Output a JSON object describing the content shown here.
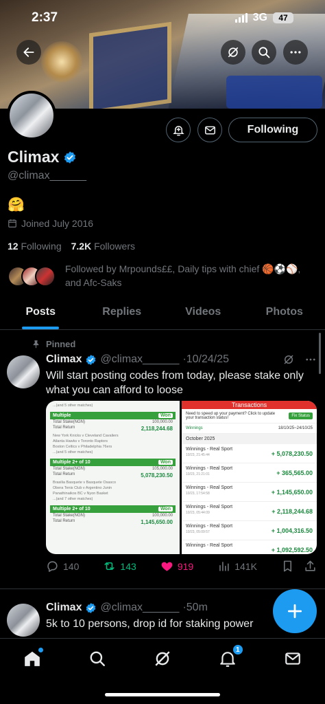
{
  "status_bar": {
    "time": "2:37",
    "network": "3G",
    "battery": "47"
  },
  "profile": {
    "name": "Climax",
    "handle": "@climax______",
    "bio_emoji": "🤗",
    "joined": "Joined July 2016",
    "following_count": "12",
    "following_label": "Following",
    "followers_count": "7.2K",
    "followers_label": "Followers",
    "followed_by": "Followed by Mrpounds££, Daily tips with chief 🏀⚽⚾, and Afc-Saks",
    "follow_button": "Following"
  },
  "tabs": [
    {
      "label": "Posts",
      "active": true
    },
    {
      "label": "Replies",
      "active": false
    },
    {
      "label": "Videos",
      "active": false
    },
    {
      "label": "Photos",
      "active": false
    }
  ],
  "pinned_label": "Pinned",
  "posts": [
    {
      "name": "Climax",
      "handle": "@climax______",
      "date": "·10/24/25",
      "text": "Will start posting codes from today, please stake only what you can afford to loose",
      "replies": "140",
      "reposts": "143",
      "likes": "919",
      "views": "141K",
      "media": {
        "left": {
          "header_note": "...(and 5 other matches)",
          "bets": [
            {
              "label": "Multiple",
              "status": "Won",
              "stake_label": "Total Stake(NGN)",
              "stake": "100,000.00",
              "return_label": "Total Return",
              "return": "2,118,244.68",
              "teams": [
                "New York Knicks v Cleveland Cavaliers",
                "Atlanta Hawks v Toronto Raptors",
                "Boston Celtics v Philadelphia 76ers",
                "...(and 5 other matches)"
              ]
            },
            {
              "label": "Multiple",
              "odds": "2+ of 10",
              "status": "Won",
              "stake_label": "Total Stake(NGN)",
              "stake": "105,000.00",
              "return_label": "Total Return",
              "return": "5,078,230.50",
              "teams": [
                "Brasilia Basquete v Basquete Osasco",
                "Obera Tenis Club v Argentino Junin",
                "Panathinaikos BC v Nyon Basket",
                "...(and 7 other matches)"
              ]
            },
            {
              "label": "Multiple",
              "odds": "2+ of 10",
              "status": "Won",
              "stake_label": "Total Stake(NGN)",
              "stake": "100,000.00",
              "return_label": "Total Return",
              "return": "1,145,650.00",
              "teams": []
            }
          ]
        },
        "right": {
          "title": "Transactions",
          "banner": "Need to speed up your payment? Click to update your transaction status!",
          "fix_button": "Fix Status",
          "filter_type": "Winnings",
          "filter_range": "18/10/25~24/10/25",
          "month": "October 2025",
          "items": [
            {
              "label": "Winnings - Real Sport",
              "time": "10/23, 21:45:44",
              "amount": "+ 5,078,230.50"
            },
            {
              "label": "Winnings - Real Sport",
              "time": "10/23, 21:21:01",
              "amount": "+ 365,565.00"
            },
            {
              "label": "Winnings - Real Sport",
              "time": "10/23, 17:54:58",
              "amount": "+ 1,145,650.00"
            },
            {
              "label": "Winnings - Real Sport",
              "time": "10/23, 05:44:09",
              "amount": "+ 2,118,244.68"
            },
            {
              "label": "Winnings - Real Sport",
              "time": "10/23, 05:09:57",
              "amount": "+ 1,004,316.50"
            },
            {
              "label": "Winnings - Real Sport",
              "time": "",
              "amount": "+ 1,092,592.50"
            }
          ]
        }
      }
    },
    {
      "name": "Climax",
      "handle": "@climax______",
      "date": "·50m",
      "text": "5k to 10 persons, drop id for staking power"
    }
  ],
  "nav": {
    "notifications_badge": "1"
  },
  "colors": {
    "accent": "#1d9bf0",
    "like": "#f91880",
    "repost": "#00ba7c",
    "background": "#000000"
  }
}
